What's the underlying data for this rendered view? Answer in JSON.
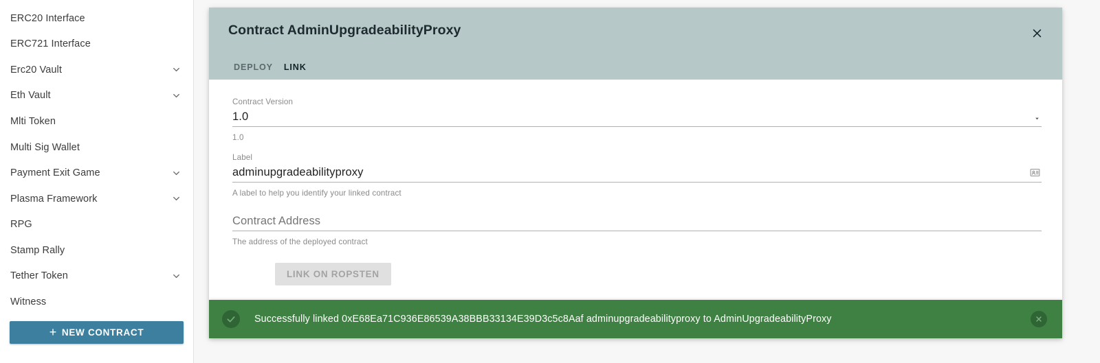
{
  "sidebar": {
    "items": [
      {
        "label": "ERC20 Interface",
        "expandable": false
      },
      {
        "label": "ERC721 Interface",
        "expandable": false
      },
      {
        "label": "Erc20 Vault",
        "expandable": true
      },
      {
        "label": "Eth Vault",
        "expandable": true
      },
      {
        "label": "Mlti Token",
        "expandable": false
      },
      {
        "label": "Multi Sig Wallet",
        "expandable": false
      },
      {
        "label": "Payment Exit Game",
        "expandable": true
      },
      {
        "label": "Plasma Framework",
        "expandable": true
      },
      {
        "label": "RPG",
        "expandable": false
      },
      {
        "label": "Stamp Rally",
        "expandable": false
      },
      {
        "label": "Tether Token",
        "expandable": true
      },
      {
        "label": "Witness",
        "expandable": false
      }
    ],
    "new_contract_label": "NEW CONTRACT"
  },
  "dialog": {
    "title": "Contract AdminUpgradeabilityProxy",
    "tabs": [
      {
        "label": "DEPLOY",
        "active": false
      },
      {
        "label": "LINK",
        "active": true
      }
    ],
    "fields": {
      "contract_version": {
        "label": "Contract Version",
        "value": "1.0",
        "help": "1.0"
      },
      "label_field": {
        "label": "Label",
        "value": "adminupgradeabilityproxy",
        "help": "A label to help you identify your linked contract"
      },
      "contract_address": {
        "label": "",
        "placeholder": "Contract Address",
        "value": "",
        "help": "The address of the deployed contract"
      }
    },
    "submit_label": "LINK ON ROPSTEN"
  },
  "snackbar": {
    "message": "Successfully linked 0xE68Ea71C936E86539A38BBB33134E39D3c5c8Aaf adminupgradeabilityproxy to AdminUpgradeabilityProxy",
    "background": "#3e8142"
  },
  "colors": {
    "accent": "#3c7f9e",
    "header_bg": "#b7c8c8",
    "success": "#3e8142",
    "page_bg": "#f7f7f7"
  }
}
